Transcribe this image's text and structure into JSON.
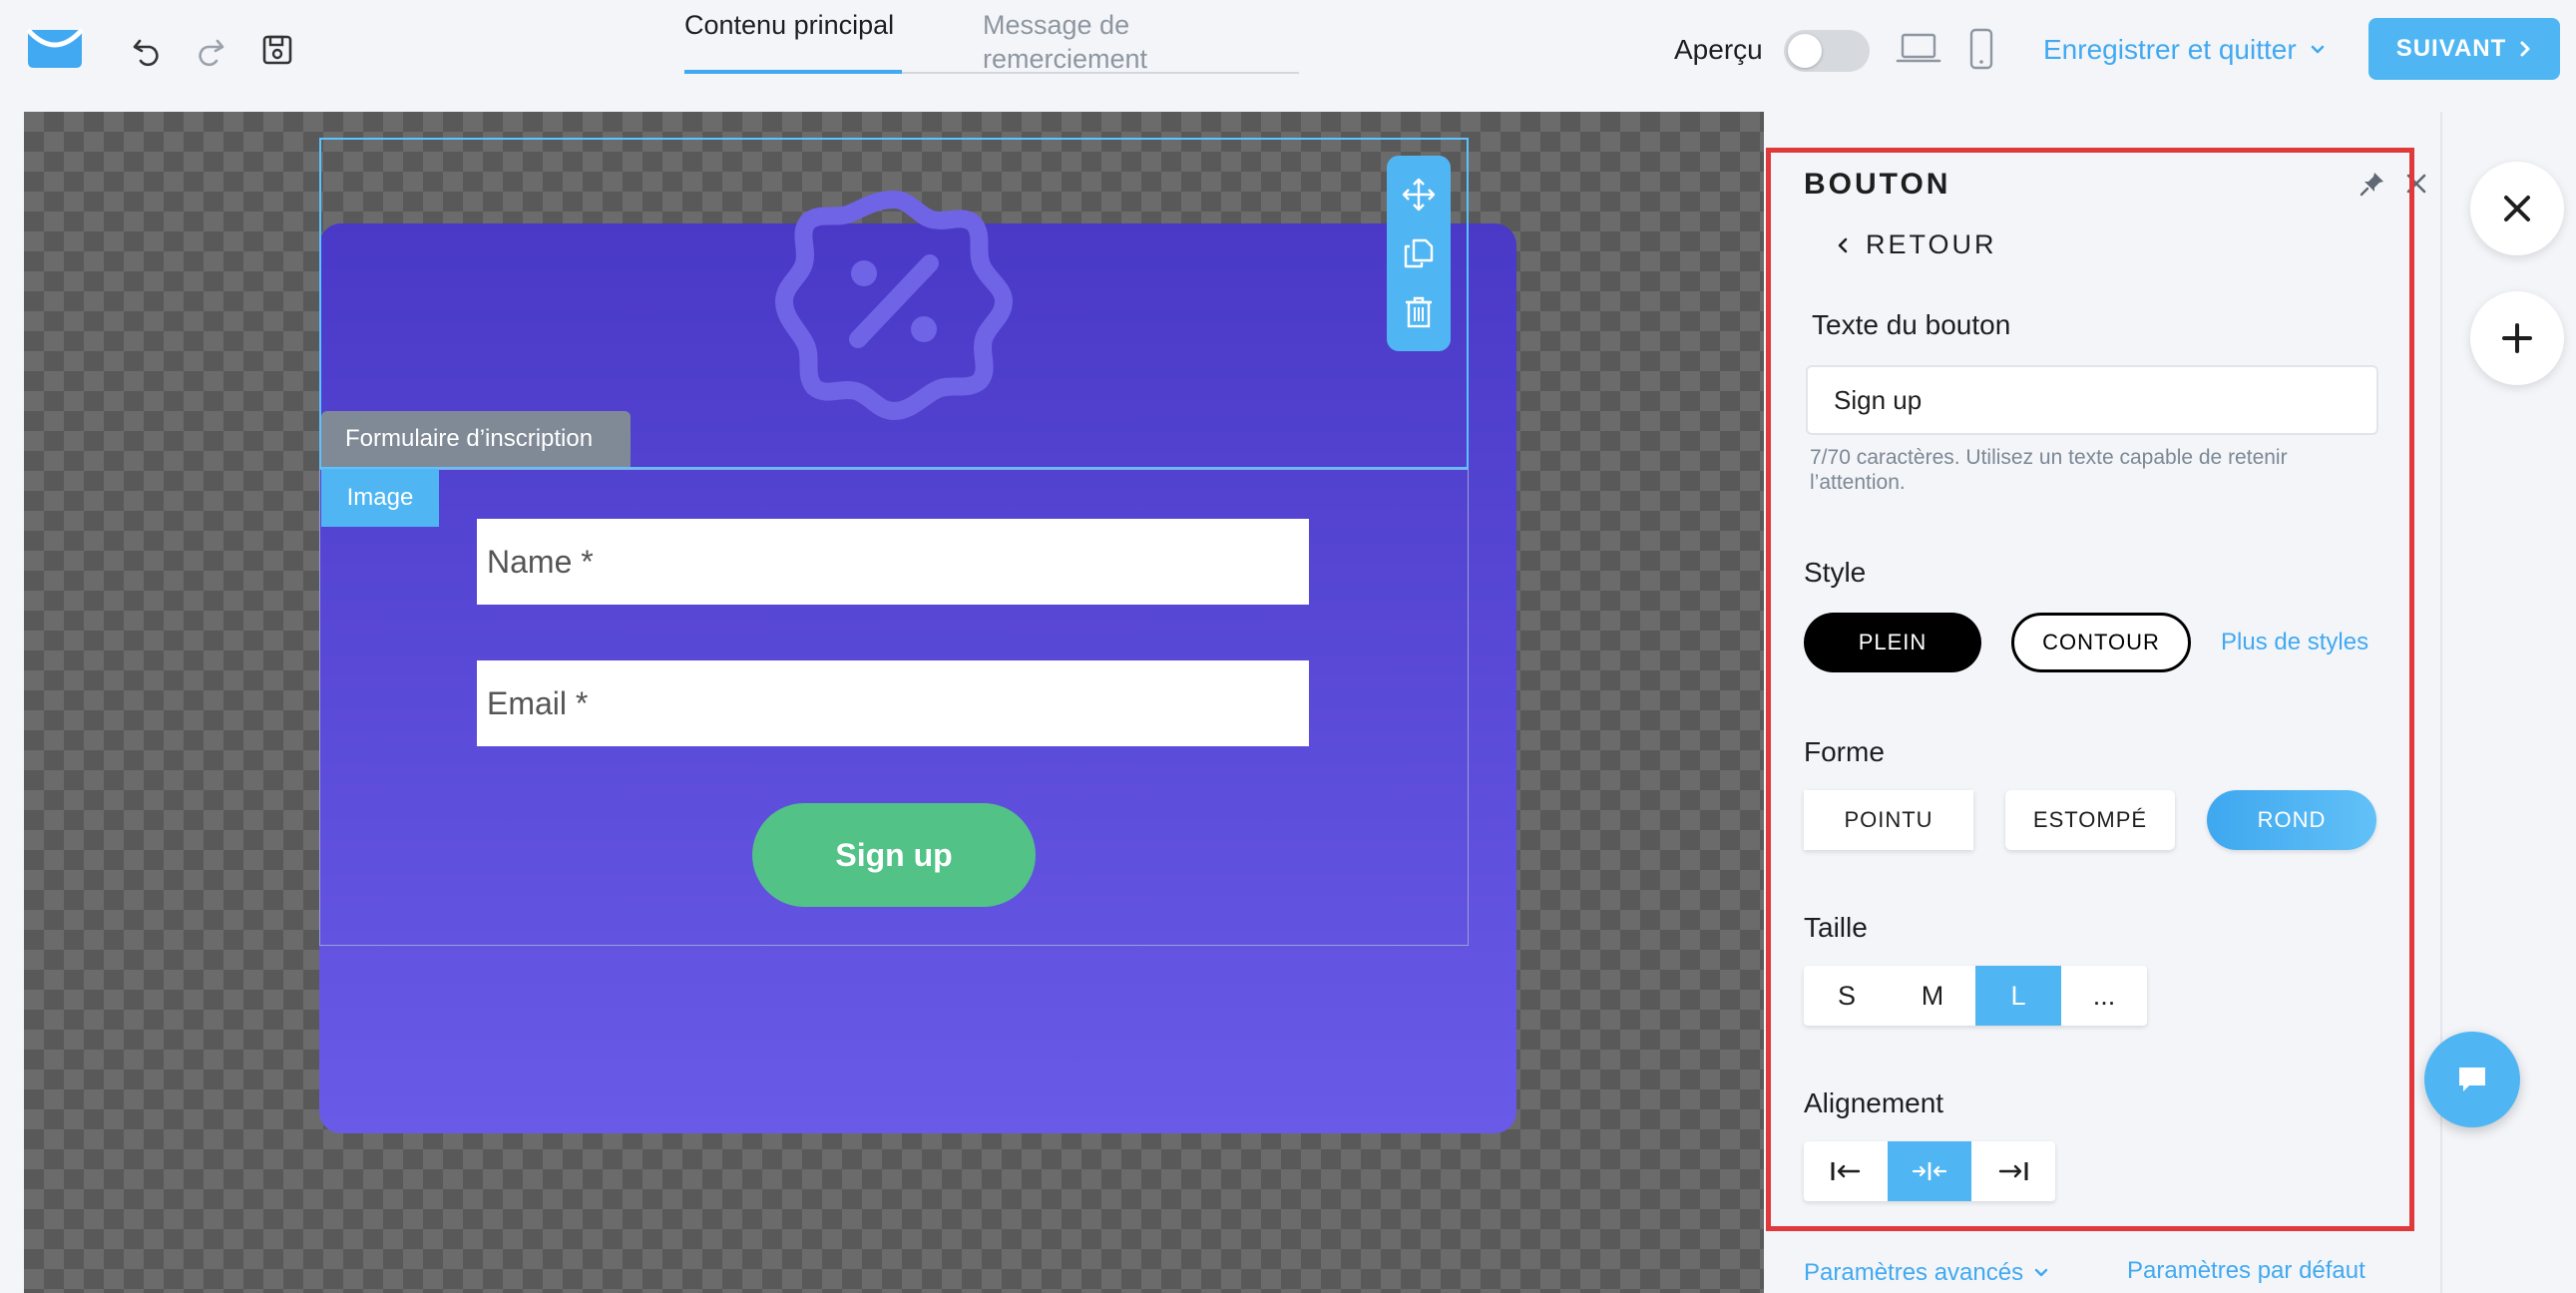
{
  "header": {
    "logo_icon": "envelope-logo-icon",
    "undo_icon": "undo-icon",
    "redo_icon": "redo-icon",
    "save_icon": "floppy-disk-icon",
    "tabs": [
      {
        "label": "Contenu principal",
        "active": true
      },
      {
        "label": "Message de remerciement",
        "active": false
      }
    ],
    "preview_label": "Aperçu",
    "preview_on": false,
    "save_quit_label": "Enregistrer et quitter",
    "next_label": "SUIVANT"
  },
  "canvas": {
    "form_label": "Formulaire d’inscription",
    "image_label": "Image",
    "name_placeholder": "Name *",
    "email_placeholder": "Email *",
    "signup_label": "Sign up",
    "colors": {
      "popup_top": "#4939c6",
      "popup_bottom": "#6a5ae8",
      "button": "#52c287",
      "accent": "#4fb6f3"
    }
  },
  "panel": {
    "title": "BOUTON",
    "back_label": "RETOUR",
    "button_text_label": "Texte du bouton",
    "button_text_value": "Sign up",
    "hint": "7/70 caractères. Utilisez un texte capable de retenir l’attention.",
    "style_label": "Style",
    "style_options": [
      "PLEIN",
      "CONTOUR"
    ],
    "style_selected": "PLEIN",
    "more_styles": "Plus de styles",
    "shape_label": "Forme",
    "shape_options": [
      "POINTU",
      "ESTOMPÉ",
      "ROND"
    ],
    "shape_selected": "ROND",
    "size_label": "Taille",
    "size_options": [
      "S",
      "M",
      "L",
      "..."
    ],
    "size_selected": "L",
    "align_label": "Alignement",
    "align_selected": "center",
    "advanced_label": "Paramètres avancés",
    "defaults_label": "Paramètres par défaut",
    "highlight_color": "#e0393c"
  }
}
